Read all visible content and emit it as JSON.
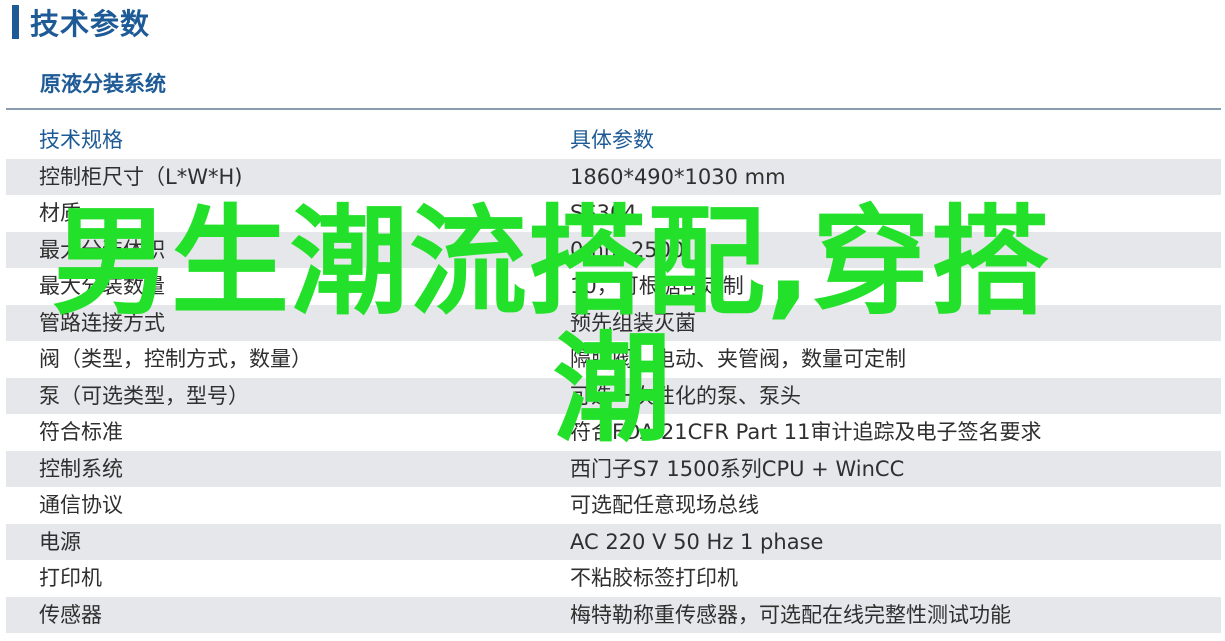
{
  "section_title": "技术参数",
  "subsection_title": "原液分装系统",
  "spec_table": {
    "header": {
      "parameter": "技术规格",
      "value": "具体参数"
    },
    "rows": [
      {
        "parameter": "控制柜尺寸（L*W*H)",
        "value": "1860*490*1030 mm"
      },
      {
        "parameter": "材质",
        "value": "SS304"
      },
      {
        "parameter": "最大分装体积",
        "value": "0mm 2500"
      },
      {
        "parameter": "最大分装数量",
        "value": "10，可根据可定制"
      },
      {
        "parameter": "管路连接方式",
        "value": "预先组装灭菌"
      },
      {
        "parameter": "阀（类型，控制方式，数量）",
        "value": "隔膜阀、电动、夹管阀，数量可定制"
      },
      {
        "parameter": "泵（可选类型，型号）",
        "value": "可选一次性化的泵、泵头"
      },
      {
        "parameter": "符合标准",
        "value": "符合FDA 21CFR Part 11审计追踪及电子签名要求"
      },
      {
        "parameter": "控制系统",
        "value": "西门子S7 1500系列CPU + WinCC"
      },
      {
        "parameter": "通信协议",
        "value": "可选配任意现场总线"
      },
      {
        "parameter": "电源",
        "value": "AC 220 V 50 Hz 1 phase"
      },
      {
        "parameter": "打印机",
        "value": "不粘胶标签打印机"
      },
      {
        "parameter": "传感器",
        "value": "梅特勒称重传感器，可选配在线完整性测试功能"
      }
    ]
  },
  "overlay": {
    "line1": "男生潮流搭配,穿搭",
    "line2": "潮"
  },
  "colors": {
    "brand_blue": "#1e5b96",
    "row_stripe": "#e5e7ea",
    "body_text": "#2f2f2f",
    "overlay_green": "#23e12a"
  }
}
